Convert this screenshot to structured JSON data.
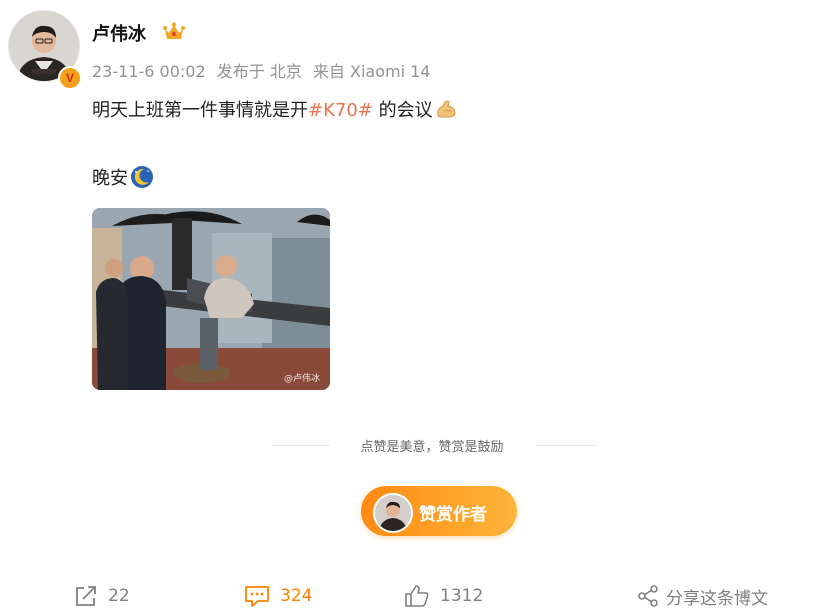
{
  "user": {
    "name": "卢伟冰",
    "verified_badge": "V",
    "crown_icon": "crown-icon"
  },
  "post": {
    "meta": {
      "time": "23-11-6 00:02",
      "location": "发布于 北京",
      "source": "来自 Xiaomi 14"
    },
    "text_before": "明天上班第一件事情就是开",
    "topic": "#K70#",
    "text_after": " 的会议",
    "text_line2": "晚安",
    "image_watermark": "@卢伟冰",
    "emoji": [
      "flexed-bicep-emoji",
      "moon-emoji"
    ]
  },
  "reward": {
    "slogan": "点赞是美意，赞赏是鼓励",
    "button_label": "赞赏作者"
  },
  "actions": {
    "repost_count": "22",
    "comment_count": "324",
    "like_count": "1312",
    "share_label": "分享这条博文"
  },
  "colors": {
    "topic": "#eb7350",
    "accent": "#ff8200",
    "reward_gradient_start": "#ff8a12",
    "reward_gradient_end": "#fdb53a",
    "muted": "#939393"
  }
}
